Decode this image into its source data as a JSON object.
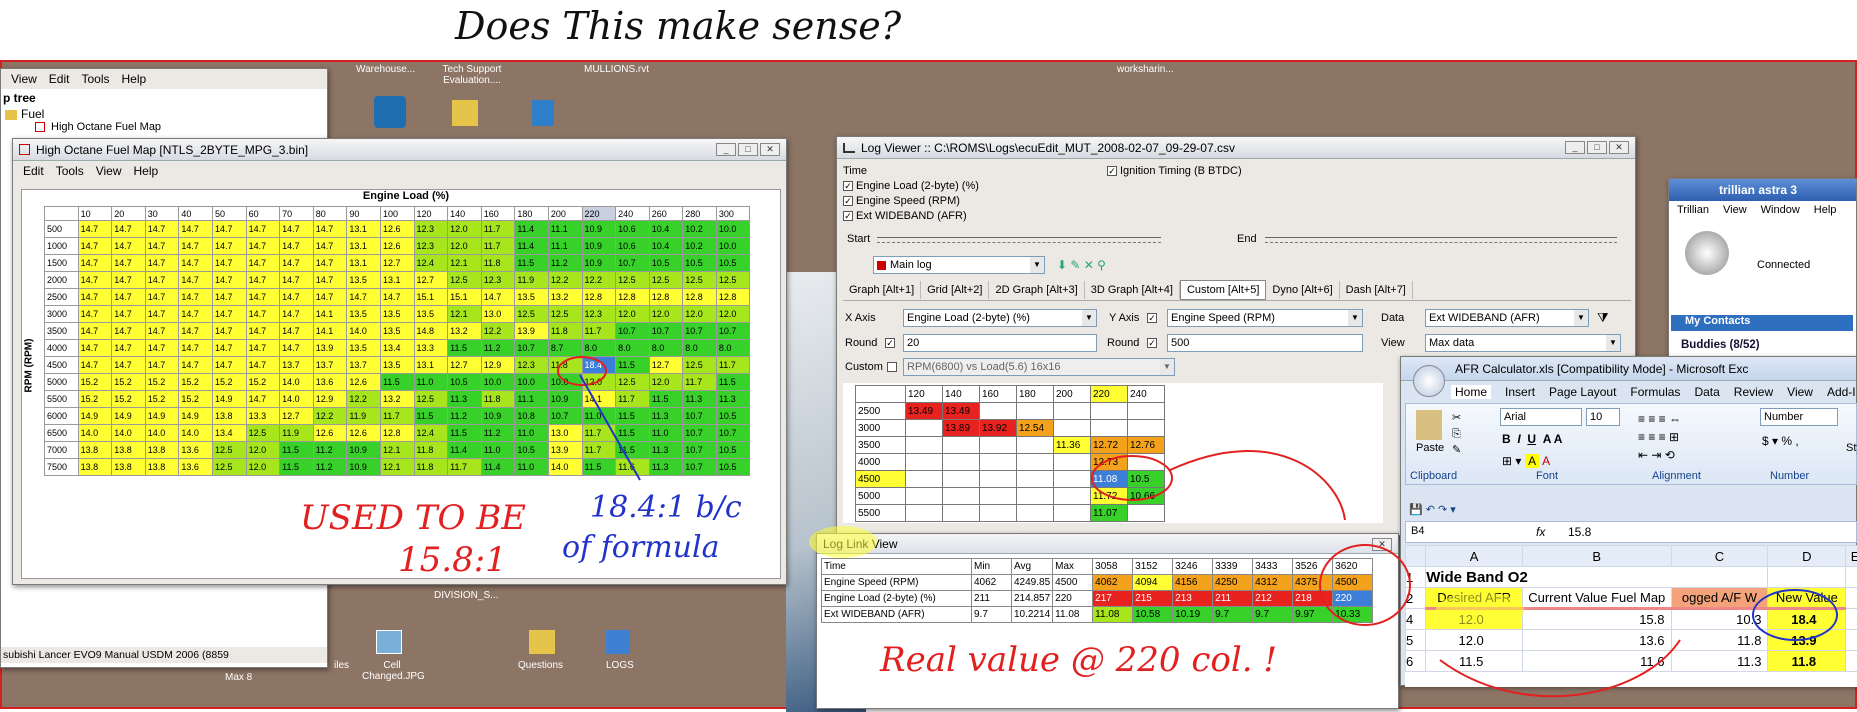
{
  "handwriting": {
    "top": "Does This make sense?",
    "used1": "USED TO BE",
    "used2": "15.8:1",
    "b1": "18.4:1 b/c",
    "b2": "of formula",
    "real": "Real value @ 220 col. !"
  },
  "colors": {
    "yellow": "#ffff33",
    "red": "#e8231f",
    "green": "#37d12a",
    "orange": "#f4a21c",
    "lime": "#a7e61c",
    "ink_red": "#e22020",
    "ink_blue": "#2233cc"
  },
  "desktop": {
    "icons": [
      "Warehouse...",
      "Tech Support Evaluation....",
      "MULLIONS.rvt",
      "worksharin...",
      "Cell Changed.JPG",
      "Questions",
      "LOGS",
      "DIVISION_S...",
      "Max 8",
      "iles"
    ]
  },
  "explorer": {
    "menu": [
      "View",
      "Edit",
      "Tools",
      "Help"
    ],
    "tree_title": "p tree",
    "folder": "Fuel",
    "item": "High Octane Fuel Map",
    "footer": "subishi Lancer EVO9 Manual USDM 2006 (8859"
  },
  "fuelmap": {
    "title": "High Octane Fuel Map [NTLS_2BYTE_MPG_3.bin]",
    "menu": [
      "Edit",
      "Tools",
      "View",
      "Help"
    ],
    "xlabel": "Engine Load (%)",
    "ylabel": "RPM (RPM)",
    "cols": [
      "10",
      "20",
      "30",
      "40",
      "50",
      "60",
      "70",
      "80",
      "90",
      "100",
      "120",
      "140",
      "160",
      "180",
      "200",
      "220",
      "240",
      "260",
      "280",
      "300"
    ],
    "rows": [
      {
        "rpm": "500",
        "v": [
          "14.7",
          "14.7",
          "14.7",
          "14.7",
          "14.7",
          "14.7",
          "14.7",
          "14.7",
          "13.1",
          "12.6",
          "12.3",
          "12.0",
          "11.7",
          "11.4",
          "11.1",
          "10.9",
          "10.6",
          "10.4",
          "10.2",
          "10.0"
        ]
      },
      {
        "rpm": "1000",
        "v": [
          "14.7",
          "14.7",
          "14.7",
          "14.7",
          "14.7",
          "14.7",
          "14.7",
          "14.7",
          "13.1",
          "12.6",
          "12.3",
          "12.0",
          "11.7",
          "11.4",
          "11.1",
          "10.9",
          "10.6",
          "10.4",
          "10.2",
          "10.0"
        ]
      },
      {
        "rpm": "1500",
        "v": [
          "14.7",
          "14.7",
          "14.7",
          "14.7",
          "14.7",
          "14.7",
          "14.7",
          "14.7",
          "13.1",
          "12.7",
          "12.4",
          "12.1",
          "11.8",
          "11.5",
          "11.2",
          "10.9",
          "10.7",
          "10.5",
          "10.5",
          "10.5"
        ]
      },
      {
        "rpm": "2000",
        "v": [
          "14.7",
          "14.7",
          "14.7",
          "14.7",
          "14.7",
          "14.7",
          "14.7",
          "14.7",
          "13.5",
          "13.1",
          "12.7",
          "12.5",
          "12.3",
          "11.9",
          "12.2",
          "12.2",
          "12.5",
          "12.5",
          "12.5",
          "12.5"
        ]
      },
      {
        "rpm": "2500",
        "v": [
          "14.7",
          "14.7",
          "14.7",
          "14.7",
          "14.7",
          "14.7",
          "14.7",
          "14.7",
          "14.7",
          "14.7",
          "15.1",
          "15.1",
          "14.7",
          "13.5",
          "13.2",
          "12.8",
          "12.8",
          "12.8",
          "12.8",
          "12.8"
        ]
      },
      {
        "rpm": "3000",
        "v": [
          "14.7",
          "14.7",
          "14.7",
          "14.7",
          "14.7",
          "14.7",
          "14.7",
          "14.1",
          "13.5",
          "13.5",
          "13.5",
          "12.1",
          "13.0",
          "12.5",
          "12.5",
          "12.3",
          "12.0",
          "12.0",
          "12.0",
          "12.0"
        ]
      },
      {
        "rpm": "3500",
        "v": [
          "14.7",
          "14.7",
          "14.7",
          "14.7",
          "14.7",
          "14.7",
          "14.7",
          "14.1",
          "14.0",
          "13.5",
          "14.8",
          "13.2",
          "12.2",
          "13.9",
          "11.8",
          "11.7",
          "10.7",
          "10.7",
          "10.7",
          "10.7"
        ]
      },
      {
        "rpm": "4000",
        "v": [
          "14.7",
          "14.7",
          "14.7",
          "14.7",
          "14.7",
          "14.7",
          "14.7",
          "13.9",
          "13.5",
          "13.4",
          "13.3",
          "11.5",
          "11.2",
          "10.7",
          "8.7",
          "8.0",
          "8.0",
          "8.0",
          "8.0",
          "8.0"
        ]
      },
      {
        "rpm": "4500",
        "v": [
          "14.7",
          "14.7",
          "14.7",
          "14.7",
          "14.7",
          "14.7",
          "13.7",
          "13.7",
          "13.7",
          "13.5",
          "13.1",
          "12.7",
          "12.9",
          "12.3",
          "11.8",
          "18.4",
          "11.5",
          "12.7",
          "12.5",
          "11.7"
        ]
      },
      {
        "rpm": "5000",
        "v": [
          "15.2",
          "15.2",
          "15.2",
          "15.2",
          "15.2",
          "15.2",
          "14.0",
          "13.6",
          "12.6",
          "11.5",
          "11.0",
          "10.5",
          "10.0",
          "10.0",
          "10.0",
          "12.0",
          "12.5",
          "12.0",
          "11.7",
          "11.5"
        ]
      },
      {
        "rpm": "5500",
        "v": [
          "15.2",
          "15.2",
          "15.2",
          "15.2",
          "14.9",
          "14.7",
          "14.0",
          "12.9",
          "12.2",
          "13.2",
          "12.5",
          "11.3",
          "11.8",
          "11.1",
          "10.9",
          "14.1",
          "11.7",
          "11.5",
          "11.3",
          "11.3"
        ]
      },
      {
        "rpm": "6000",
        "v": [
          "14.9",
          "14.9",
          "14.9",
          "14.9",
          "13.8",
          "13.3",
          "12.7",
          "12.2",
          "11.9",
          "11.7",
          "11.5",
          "11.2",
          "10.9",
          "10.8",
          "10.7",
          "11.0",
          "11.5",
          "11.3",
          "10.7",
          "10.5"
        ]
      },
      {
        "rpm": "6500",
        "v": [
          "14.0",
          "14.0",
          "14.0",
          "14.0",
          "13.4",
          "12.5",
          "11.9",
          "12.6",
          "12.6",
          "12.8",
          "12.4",
          "11.5",
          "11.2",
          "11.0",
          "13.0",
          "11.7",
          "11.5",
          "11.0",
          "10.7",
          "10.7"
        ]
      },
      {
        "rpm": "7000",
        "v": [
          "13.8",
          "13.8",
          "13.8",
          "13.6",
          "12.5",
          "12.0",
          "11.5",
          "11.2",
          "10.9",
          "12.1",
          "11.8",
          "11.4",
          "11.0",
          "10.5",
          "13.9",
          "11.7",
          "11.5",
          "11.3",
          "10.7",
          "10.5"
        ]
      },
      {
        "rpm": "7500",
        "v": [
          "13.8",
          "13.8",
          "13.8",
          "13.6",
          "12.5",
          "12.0",
          "11.5",
          "11.2",
          "10.9",
          "12.1",
          "11.8",
          "11.7",
          "11.4",
          "11.0",
          "14.0",
          "11.5",
          "11.6",
          "11.3",
          "10.7",
          "10.5"
        ]
      }
    ]
  },
  "logviewer": {
    "title": "Log Viewer :: C:\\ROMS\\Logs\\ecuEdit_MUT_2008-02-07_09-29-07.csv",
    "checks": [
      "Time",
      "Engine Load (2-byte) (%)",
      "Engine Speed (RPM)",
      "Ext WIDEBAND (AFR)"
    ],
    "check_right": "Ignition Timing (B BTDC)",
    "start": "Start",
    "end": "End",
    "mainlog": "Main log",
    "tabs": [
      "Graph [Alt+1]",
      "Grid [Alt+2]",
      "2D Graph [Alt+3]",
      "3D Graph [Alt+4]",
      "Custom [Alt+5]",
      "Dyno [Alt+6]",
      "Dash [Alt+7]"
    ],
    "xaxis_label": "X Axis",
    "xaxis": "Engine Load (2-byte) (%)",
    "yaxis_label": "Y Axis",
    "yaxis": "Engine Speed (RPM)",
    "data_label": "Data",
    "data": "Ext WIDEBAND (AFR)",
    "round_label": "Round",
    "round1": "20",
    "round2": "500",
    "view_label": "View",
    "view": "Max data",
    "custom_label": "Custom",
    "custom": "RPM(6800) vs Load(5.6) 16x16",
    "grid_cols": [
      "120",
      "140",
      "160",
      "180",
      "200",
      "220",
      "240"
    ],
    "grid_rows": [
      {
        "rpm": "2500",
        "c": [
          "13.49",
          "13.49",
          "",
          "",
          "",
          "",
          ""
        ]
      },
      {
        "rpm": "3000",
        "c": [
          "",
          "13.89",
          "13.92",
          "12.54",
          "",
          "",
          ""
        ]
      },
      {
        "rpm": "3500",
        "c": [
          "",
          "",
          "",
          "",
          "11.36",
          "12.72",
          "12.76"
        ]
      },
      {
        "rpm": "4000",
        "c": [
          "",
          "",
          "",
          "",
          "",
          "12.73",
          ""
        ]
      },
      {
        "rpm": "4500",
        "c": [
          "",
          "",
          "",
          "",
          "",
          "11.08",
          "10.5"
        ]
      },
      {
        "rpm": "5000",
        "c": [
          "",
          "",
          "",
          "",
          "",
          "11.72",
          "10.66"
        ]
      },
      {
        "rpm": "5500",
        "c": [
          "",
          "",
          "",
          "",
          "",
          "11.07",
          ""
        ]
      }
    ]
  },
  "loglink": {
    "title": "Log Link View",
    "headers": [
      "Time",
      "Min",
      "Avg",
      "Max",
      "3058",
      "3152",
      "3246",
      "3339",
      "3433",
      "3526",
      "3620"
    ],
    "rows": [
      [
        "Engine Speed (RPM)",
        "4062",
        "4249.85",
        "4500",
        "4062",
        "4094",
        "4156",
        "4250",
        "4312",
        "4375",
        "4500"
      ],
      [
        "Engine Load (2-byte) (%)",
        "211",
        "214.857",
        "220",
        "217",
        "215",
        "213",
        "211",
        "212",
        "218",
        "220"
      ],
      [
        "Ext WIDEBAND (AFR)",
        "9.7",
        "10.2214",
        "11.08",
        "11.08",
        "10.58",
        "10.19",
        "9.7",
        "9.7",
        "9.97",
        "10.33"
      ]
    ]
  },
  "trillian": {
    "title": "trillian astra 3",
    "menu": [
      "Trillian",
      "View",
      "Window",
      "Help"
    ],
    "status": "Connected",
    "contacts": "My Contacts",
    "buddies": "Buddies (8/52)"
  },
  "excel": {
    "title": "AFR Calculator.xls  [Compatibility Mode] - Microsoft Exc",
    "ribbon_tabs": [
      "Home",
      "Insert",
      "Page Layout",
      "Formulas",
      "Data",
      "Review",
      "View",
      "Add-I"
    ],
    "font": "Arial",
    "size": "10",
    "numfmt": "Number",
    "groups": [
      "Clipboard",
      "Font",
      "Alignment",
      "Number"
    ],
    "paste": "Paste",
    "sty": "Sty",
    "namebox": "B4",
    "fx": "fx",
    "formula": "15.8",
    "cols": [
      "A",
      "B",
      "C",
      "D",
      "E"
    ],
    "row1": "Wide Band O2",
    "row2": [
      "Desired AFR",
      "Current Value Fuel Map",
      "ogged A/F W",
      "New Value"
    ],
    "rows": [
      {
        "n": "4",
        "v": [
          "12.0",
          "15.8",
          "10.3",
          "18.4"
        ]
      },
      {
        "n": "5",
        "v": [
          "12.0",
          "13.6",
          "11.8",
          "13.9"
        ]
      },
      {
        "n": "6",
        "v": [
          "11.5",
          "11.6",
          "11.3",
          "11.8"
        ]
      }
    ]
  }
}
